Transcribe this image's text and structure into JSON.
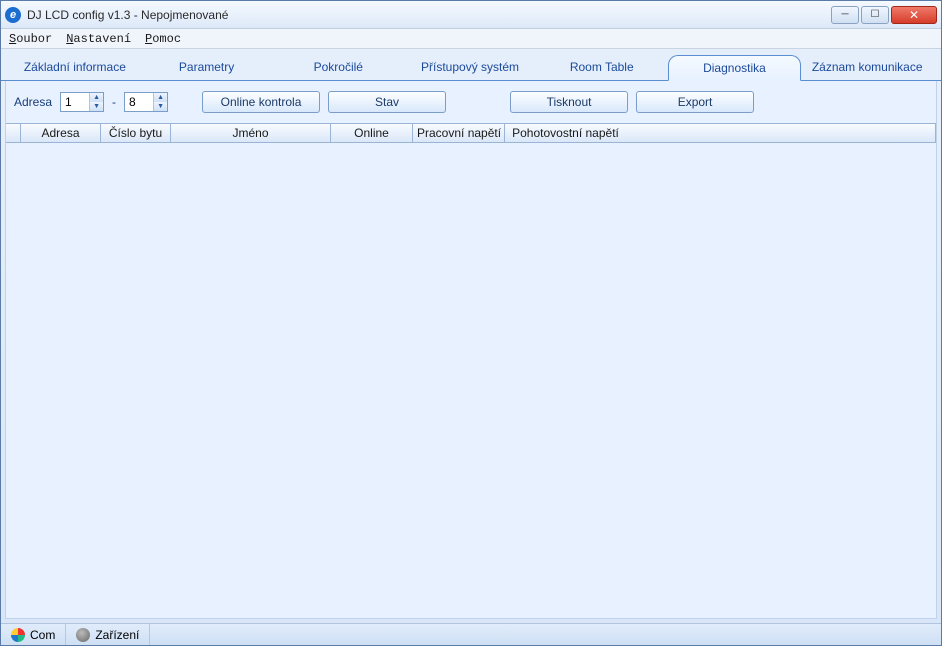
{
  "window": {
    "title": "DJ LCD config v1.3 - Nepojmenované"
  },
  "menu": {
    "file": "Soubor",
    "settings": "Nastavení",
    "help": "Pomoc"
  },
  "tabs": {
    "t0": "Základní informace",
    "t1": "Parametry",
    "t2": "Pokročilé",
    "t3": "Přístupový systém",
    "t4": "Room Table",
    "t5": "Diagnostika",
    "t6": "Záznam komunikace"
  },
  "toolbar": {
    "address_label": "Adresa",
    "addr_from": "1",
    "addr_to": "8",
    "dash": "-",
    "online_check": "Online kontrola",
    "state": "Stav",
    "print": "Tisknout",
    "export": "Export"
  },
  "grid": {
    "columns": {
      "c1": "Adresa",
      "c2": "Číslo bytu",
      "c3": "Jméno",
      "c4": "Online",
      "c5": "Pracovní napětí",
      "c6": "Pohotovostní napětí"
    }
  },
  "status": {
    "com": "Com",
    "device": "Zařízení"
  }
}
